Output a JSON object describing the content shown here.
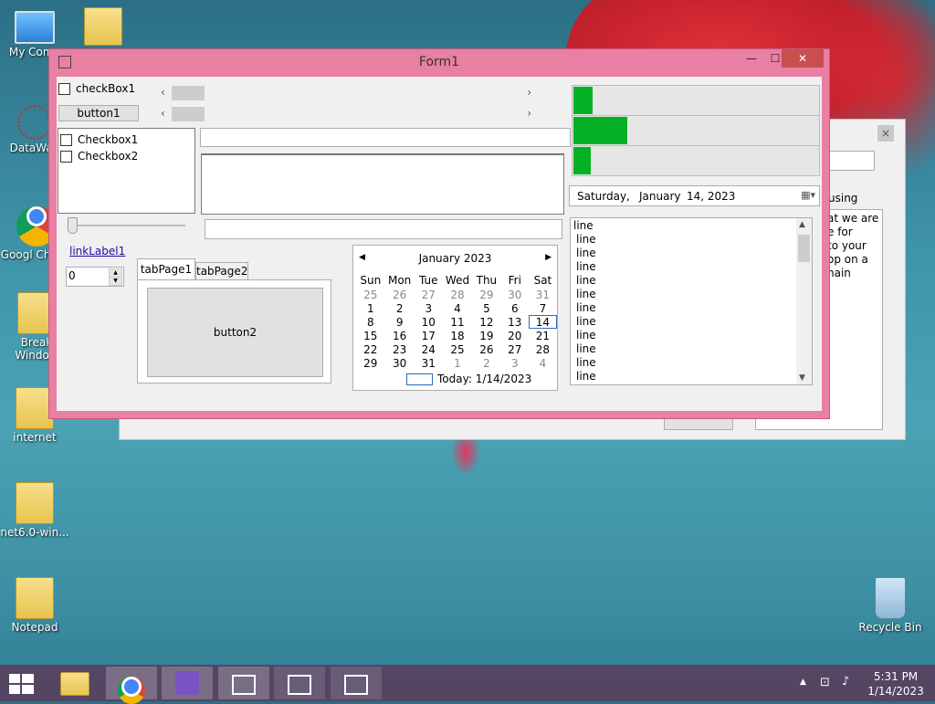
{
  "desktop": {
    "icons": [
      {
        "label": "My Comp"
      },
      {
        "label": "DataWag"
      },
      {
        "label": "Googl Chrom"
      },
      {
        "label": "Break Window"
      },
      {
        "label": "internet"
      },
      {
        "label": "net6.0-win..."
      },
      {
        "label": "Notepad"
      },
      {
        "label": "Recycle Bin"
      }
    ]
  },
  "back_window": {
    "text_lines": [
      "using",
      "at we are",
      "e for",
      "to your",
      "op on a",
      "nain"
    ]
  },
  "form1": {
    "title": "Form1",
    "checkbox1_label": "checkBox1",
    "button1_label": "button1",
    "checkedlist_items": [
      "Checkbox1",
      "Checkbox2"
    ],
    "link_label": "linkLabel1",
    "numeric_value": "0",
    "tabs": [
      "tabPage1",
      "tabPage2"
    ],
    "button2_label": "button2",
    "progress": [
      0.08,
      0.22,
      0.07
    ],
    "datepicker": {
      "day": "Saturday",
      "sep": ",",
      "month": "January",
      "date": "14, 2023"
    },
    "calendar": {
      "header": "January 2023",
      "weekdays": [
        "Sun",
        "Mon",
        "Tue",
        "Wed",
        "Thu",
        "Fri",
        "Sat"
      ],
      "rows": [
        [
          "25",
          "26",
          "27",
          "28",
          "29",
          "30",
          "31"
        ],
        [
          "1",
          "2",
          "3",
          "4",
          "5",
          "6",
          "7"
        ],
        [
          "8",
          "9",
          "10",
          "11",
          "12",
          "13",
          "14"
        ],
        [
          "15",
          "16",
          "17",
          "18",
          "19",
          "20",
          "21"
        ],
        [
          "22",
          "23",
          "24",
          "25",
          "26",
          "27",
          "28"
        ],
        [
          "29",
          "30",
          "31",
          "1",
          "2",
          "3",
          "4"
        ]
      ],
      "today_label": "Today: 1/14/2023"
    },
    "listbox_items": [
      "line",
      "line",
      "line",
      "line",
      "line",
      "line",
      "line",
      "line",
      "line",
      "line",
      "line",
      "line"
    ]
  },
  "taskbar": {
    "time": "5:31 PM",
    "date": "1/14/2023"
  }
}
